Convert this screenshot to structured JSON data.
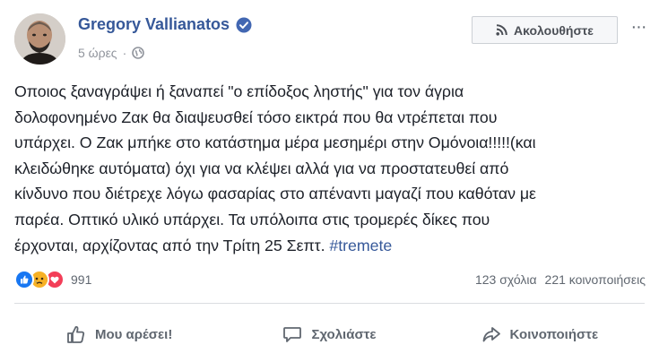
{
  "author": {
    "name": "Gregory Vallianatos",
    "verified_icon": "verified-badge-icon",
    "time": "5 ώρες",
    "separator": "·",
    "privacy_icon": "globe-icon"
  },
  "header": {
    "follow_label": "Ακολουθήστε",
    "follow_icon": "rss-icon",
    "more_label": "···"
  },
  "post": {
    "lines": [
      "Οποιος ξαναγράψει ή ξαναπεί \"ο επίδοξος ληστής\" για τον άγρια",
      "δολοφονημένο Ζακ θα διαψευσθεί τόσο εικτρά που θα ντρέπεται που",
      "υπάρχει. Ο Ζακ μπήκε στο κατάστημα μέρα μεσημέρι στην Ομόνοια!!!!!(και",
      "κλειδώθηκε αυτόματα) όχι για να κλέψει αλλά για να προστατευθεί από",
      "κίνδυνο που διέτρεχε λόγω φασαρίας στο απέναντι μαγαζί που καθόταν με",
      "παρέα. Οπτικό υλικό υπάρχει. Τα υπόλοιπα στις τρομερές δίκες που",
      "έρχονται, αρχίζοντας από την Τρίτη 25 Σεπτ."
    ],
    "hashtag": "#tremete"
  },
  "reactions": {
    "icons": [
      "like-reaction-icon",
      "sad-reaction-icon",
      "love-reaction-icon"
    ],
    "count": "991",
    "comments": "123 σχόλια",
    "shares": "221 κοινοποιήσεις"
  },
  "actions": {
    "like_label": "Μου αρέσει!",
    "comment_label": "Σχολιάστε",
    "share_label": "Κοινοποιήστε"
  },
  "colors": {
    "link": "#365899",
    "text": "#1d2129",
    "muted": "#606770",
    "like": "#1877f2",
    "sad": "#f7b125",
    "love": "#f33e58"
  }
}
